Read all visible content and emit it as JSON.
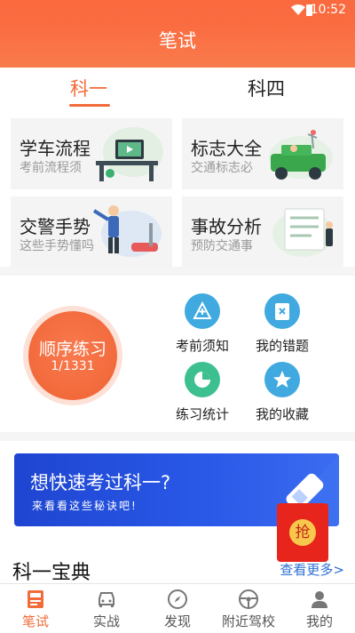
{
  "status_bar": {
    "time": "10:52"
  },
  "header": {
    "title": "笔试"
  },
  "tabs": [
    {
      "label": "科一",
      "active": true
    },
    {
      "label": "科四",
      "active": false
    }
  ],
  "cards": [
    {
      "title": "学车流程",
      "subtitle": "考前流程须"
    },
    {
      "title": "标志大全",
      "subtitle": "交通标志必"
    },
    {
      "title": "交警手势",
      "subtitle": "这些手势懂吗"
    },
    {
      "title": "事故分析",
      "subtitle": "预防交通事"
    }
  ],
  "practice": {
    "label": "顺序练习",
    "progress": "1/1331"
  },
  "quick_items": [
    {
      "label": "考前须知",
      "icon": "exam-notice-icon",
      "color": "#3fa9e0"
    },
    {
      "label": "我的错题",
      "icon": "wrong-book-icon",
      "color": "#3fa9e0"
    },
    {
      "label": "练习统计",
      "icon": "pie-chart-icon",
      "color": "#3cc08f"
    },
    {
      "label": "我的收藏",
      "icon": "star-icon",
      "color": "#3fa9e0"
    }
  ],
  "banner": {
    "title": "想快速考过科一?",
    "subtitle": "来看看这些秘诀吧!"
  },
  "red_packet": {
    "label": "抢"
  },
  "section": {
    "title": "科一宝典",
    "more": "查看更多>"
  },
  "bottom_nav": [
    {
      "label": "笔试",
      "icon": "exam-icon",
      "active": true
    },
    {
      "label": "实战",
      "icon": "car-icon",
      "active": false
    },
    {
      "label": "发现",
      "icon": "compass-icon",
      "active": false
    },
    {
      "label": "附近驾校",
      "icon": "steering-wheel-icon",
      "active": false
    },
    {
      "label": "我的",
      "icon": "profile-icon",
      "active": false
    }
  ],
  "colors": {
    "accent": "#f26b3a",
    "header": "#fa6b40",
    "banner": "#2a59e8",
    "link": "#2d6fd1"
  }
}
